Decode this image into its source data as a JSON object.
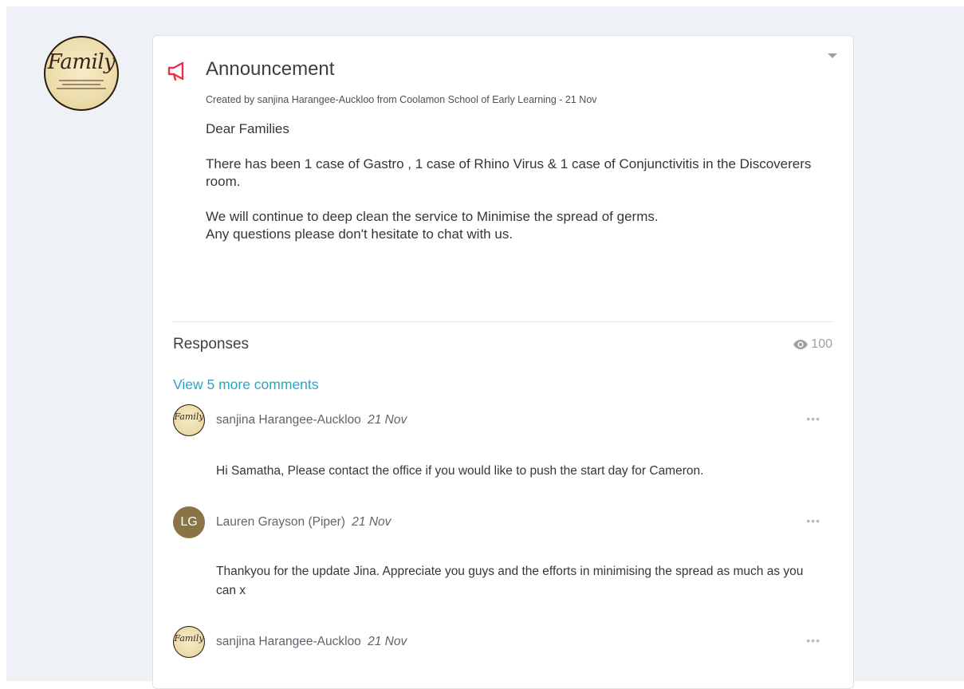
{
  "avatar": {
    "logo_word": "Family"
  },
  "announcement": {
    "icon": "megaphone-icon",
    "title": "Announcement",
    "meta": "Created by sanjina Harangee-Auckloo from Coolamon School of Early Learning - 21 Nov",
    "body": [
      "Dear Families",
      "",
      "There has been  1 case of Gastro , 1 case of Rhino Virus & 1 case of Conjunctivitis   in the Discoverers room.",
      "",
      "We will continue to deep clean the service to Minimise the spread of germs.",
      "Any questions please don't hesitate to chat with us."
    ],
    "accent_color": "#e8304a"
  },
  "responses": {
    "title": "Responses",
    "views": "100",
    "view_more": "View 5 more comments",
    "link_color": "#2ba4c6",
    "comments": [
      {
        "author": "sanjina Harangee-Auckloo",
        "date": "21 Nov",
        "avatar_type": "logo",
        "avatar_text": "Family",
        "text": "Hi Samatha, Please contact the office if you would like to push the start day for Cameron.",
        "menu": "•••"
      },
      {
        "author": "Lauren Grayson (Piper)",
        "date": "21 Nov",
        "avatar_type": "initials",
        "avatar_text": "LG",
        "text": "Thankyou for the update Jina. Appreciate you guys and the efforts in minimising the spread as much as you can x",
        "menu": "•••"
      },
      {
        "author": "sanjina Harangee-Auckloo",
        "date": "21 Nov",
        "avatar_type": "logo",
        "avatar_text": "Family",
        "text": "",
        "menu": "•••"
      }
    ]
  }
}
